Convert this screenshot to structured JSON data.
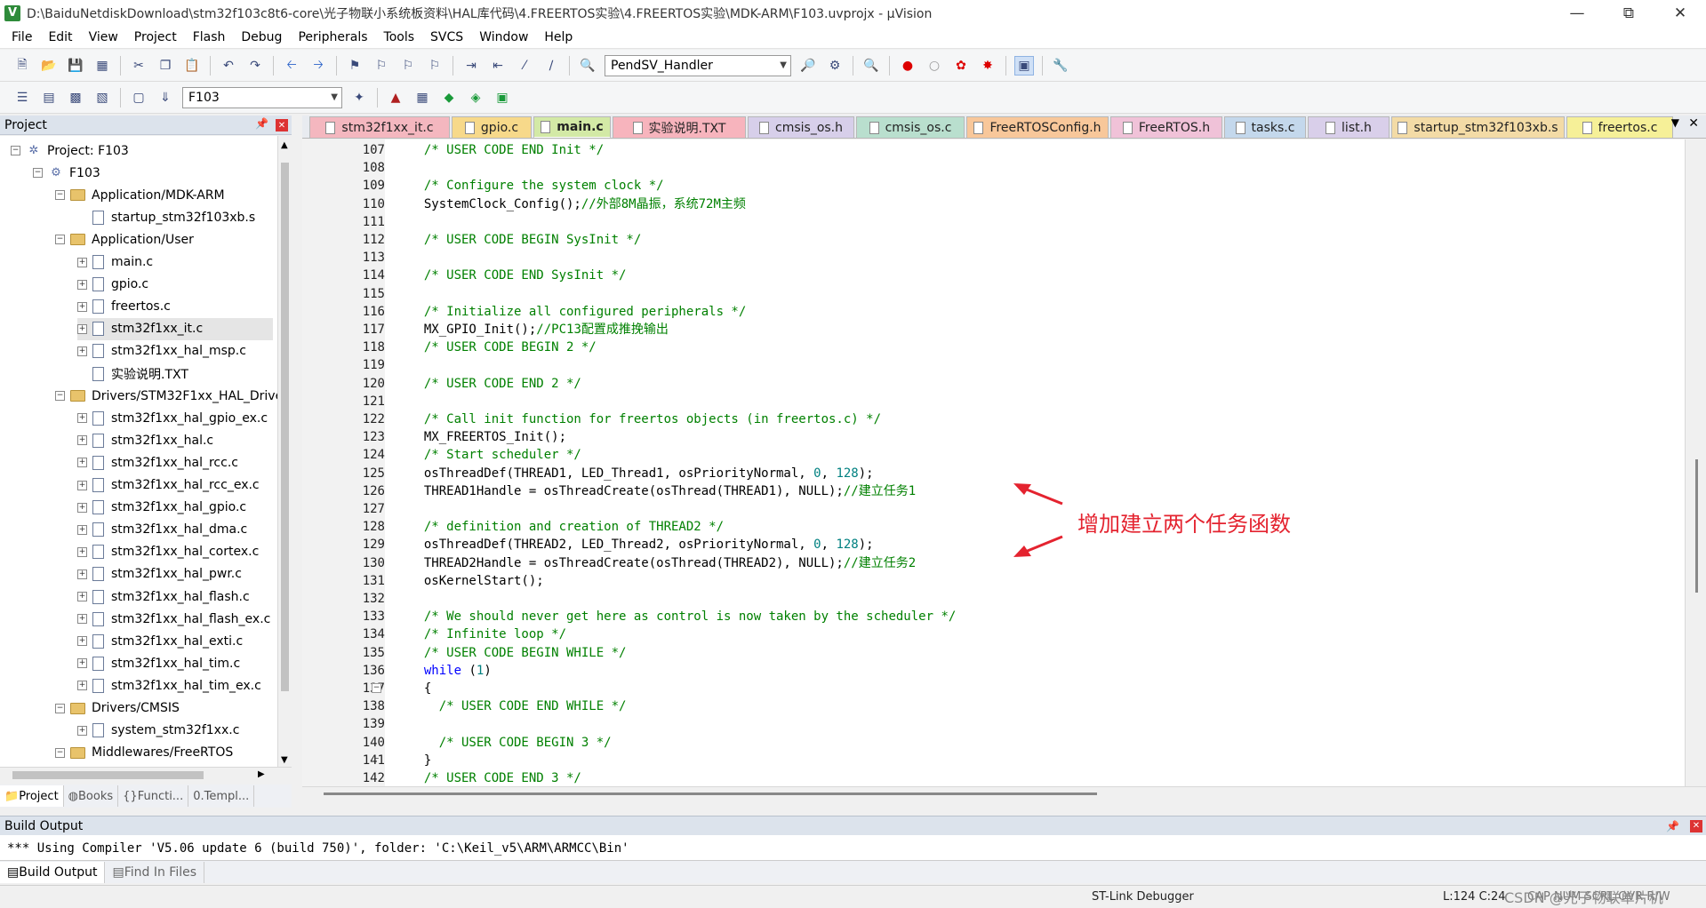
{
  "window": {
    "title": "D:\\BaiduNetdiskDownload\\stm32f103c8t6-core\\光子物联小系统板资料\\HAL库代码\\4.FREERTOS实验\\4.FREERTOS实验\\MDK-ARM\\F103.uvprojx - µVision",
    "icon_letter": "V"
  },
  "menu": [
    "File",
    "Edit",
    "View",
    "Project",
    "Flash",
    "Debug",
    "Peripherals",
    "Tools",
    "SVCS",
    "Window",
    "Help"
  ],
  "toolbar1": {
    "function_combo": "PendSV_Handler"
  },
  "toolbar2": {
    "target_combo": "F103"
  },
  "project_panel": {
    "title": "Project",
    "tree": [
      {
        "label": "Project: F103",
        "depth": 0,
        "kind": "project",
        "exp": "⊟"
      },
      {
        "label": "F103",
        "depth": 1,
        "kind": "target",
        "exp": "⊟"
      },
      {
        "label": "Application/MDK-ARM",
        "depth": 2,
        "kind": "folder",
        "exp": "⊟"
      },
      {
        "label": "startup_stm32f103xb.s",
        "depth": 3,
        "kind": "file",
        "exp": ""
      },
      {
        "label": "Application/User",
        "depth": 2,
        "kind": "folder",
        "exp": "⊟"
      },
      {
        "label": "main.c",
        "depth": 3,
        "kind": "file",
        "exp": "⊞"
      },
      {
        "label": "gpio.c",
        "depth": 3,
        "kind": "file",
        "exp": "⊞"
      },
      {
        "label": "freertos.c",
        "depth": 3,
        "kind": "file",
        "exp": "⊞"
      },
      {
        "label": "stm32f1xx_it.c",
        "depth": 3,
        "kind": "file",
        "exp": "⊞",
        "selected": true
      },
      {
        "label": "stm32f1xx_hal_msp.c",
        "depth": 3,
        "kind": "file",
        "exp": "⊞"
      },
      {
        "label": "实验说明.TXT",
        "depth": 3,
        "kind": "file",
        "exp": ""
      },
      {
        "label": "Drivers/STM32F1xx_HAL_Drive",
        "depth": 2,
        "kind": "folder",
        "exp": "⊟"
      },
      {
        "label": "stm32f1xx_hal_gpio_ex.c",
        "depth": 3,
        "kind": "file",
        "exp": "⊞"
      },
      {
        "label": "stm32f1xx_hal.c",
        "depth": 3,
        "kind": "file",
        "exp": "⊞"
      },
      {
        "label": "stm32f1xx_hal_rcc.c",
        "depth": 3,
        "kind": "file",
        "exp": "⊞"
      },
      {
        "label": "stm32f1xx_hal_rcc_ex.c",
        "depth": 3,
        "kind": "file",
        "exp": "⊞"
      },
      {
        "label": "stm32f1xx_hal_gpio.c",
        "depth": 3,
        "kind": "file",
        "exp": "⊞"
      },
      {
        "label": "stm32f1xx_hal_dma.c",
        "depth": 3,
        "kind": "file",
        "exp": "⊞"
      },
      {
        "label": "stm32f1xx_hal_cortex.c",
        "depth": 3,
        "kind": "file",
        "exp": "⊞"
      },
      {
        "label": "stm32f1xx_hal_pwr.c",
        "depth": 3,
        "kind": "file",
        "exp": "⊞"
      },
      {
        "label": "stm32f1xx_hal_flash.c",
        "depth": 3,
        "kind": "file",
        "exp": "⊞"
      },
      {
        "label": "stm32f1xx_hal_flash_ex.c",
        "depth": 3,
        "kind": "file",
        "exp": "⊞"
      },
      {
        "label": "stm32f1xx_hal_exti.c",
        "depth": 3,
        "kind": "file",
        "exp": "⊞"
      },
      {
        "label": "stm32f1xx_hal_tim.c",
        "depth": 3,
        "kind": "file",
        "exp": "⊞"
      },
      {
        "label": "stm32f1xx_hal_tim_ex.c",
        "depth": 3,
        "kind": "file",
        "exp": "⊞"
      },
      {
        "label": "Drivers/CMSIS",
        "depth": 2,
        "kind": "folder",
        "exp": "⊟"
      },
      {
        "label": "system_stm32f1xx.c",
        "depth": 3,
        "kind": "file",
        "exp": "⊞"
      },
      {
        "label": "Middlewares/FreeRTOS",
        "depth": 2,
        "kind": "folder",
        "exp": "⊟"
      }
    ],
    "tabs": [
      {
        "label": "Project",
        "icon": "📁",
        "active": true
      },
      {
        "label": "Books",
        "icon": "◍",
        "active": false
      },
      {
        "label": "Functi...",
        "icon": "{}",
        "active": false
      },
      {
        "label": "Templ...",
        "icon": "0.",
        "active": false
      }
    ]
  },
  "editor_tabs": [
    {
      "label": "stm32f1xx_it.c",
      "color": "#f4b7bf"
    },
    {
      "label": "gpio.c",
      "color": "#f7d98a"
    },
    {
      "label": "main.c",
      "color": "#d3e9a6",
      "active": true
    },
    {
      "label": "实验说明.TXT",
      "color": "#f7b4bd"
    },
    {
      "label": "cmsis_os.h",
      "color": "#d7cfea"
    },
    {
      "label": "cmsis_os.c",
      "color": "#b9dfce"
    },
    {
      "label": "FreeRTOSConfig.h",
      "color": "#f8c79a"
    },
    {
      "label": "FreeRTOS.h",
      "color": "#f0c2d8"
    },
    {
      "label": "tasks.c",
      "color": "#c4d8ec"
    },
    {
      "label": "list.h",
      "color": "#d9cfea"
    },
    {
      "label": "startup_stm32f103xb.s",
      "color": "#f3dba6"
    },
    {
      "label": "freertos.c",
      "color": "#f6f098"
    }
  ],
  "code_lines": [
    {
      "n": "107",
      "t": "  /* USER CODE END Init */",
      "k": "cm"
    },
    {
      "n": "108",
      "t": "",
      "k": ""
    },
    {
      "n": "109",
      "t": "  /* Configure the system clock */",
      "k": "cm"
    },
    {
      "n": "110",
      "t": "  SystemClock_Config();",
      "c": "//外部8M晶振，系统72M主频"
    },
    {
      "n": "111",
      "t": "",
      "k": ""
    },
    {
      "n": "112",
      "t": "  /* USER CODE BEGIN SysInit */",
      "k": "cm"
    },
    {
      "n": "113",
      "t": "",
      "k": ""
    },
    {
      "n": "114",
      "t": "  /* USER CODE END SysInit */",
      "k": "cm"
    },
    {
      "n": "115",
      "t": "",
      "k": ""
    },
    {
      "n": "116",
      "t": "  /* Initialize all configured peripherals */",
      "k": "cm"
    },
    {
      "n": "117",
      "t": "  MX_GPIO_Init();",
      "c": "//PC13配置成推挽输出"
    },
    {
      "n": "118",
      "t": "  /* USER CODE BEGIN 2 */",
      "k": "cm"
    },
    {
      "n": "119",
      "t": "",
      "k": ""
    },
    {
      "n": "120",
      "t": "  /* USER CODE END 2 */",
      "k": "cm"
    },
    {
      "n": "121",
      "t": "",
      "k": ""
    },
    {
      "n": "122",
      "t": "  /* Call init function for freertos objects (in freertos.c) */",
      "k": "cm"
    },
    {
      "n": "123",
      "t": "  MX_FREERTOS_Init();",
      "k": ""
    },
    {
      "n": "124",
      "t": "  /* Start scheduler */",
      "k": "cm"
    },
    {
      "n": "125",
      "t": "  osThreadDef(THREAD1, LED_Thread1, osPriorityNormal, ",
      "num": "0",
      "t2": ", ",
      "num2": "128",
      "t3": ");"
    },
    {
      "n": "126",
      "t": "  THREAD1Handle = osThreadCreate(osThread(THREAD1), NULL);",
      "c": "//建立任务1"
    },
    {
      "n": "127",
      "t": "",
      "k": ""
    },
    {
      "n": "128",
      "t": "  /* definition and creation of THREAD2 */",
      "k": "cm"
    },
    {
      "n": "129",
      "t": "  osThreadDef(THREAD2, LED_Thread2, osPriorityNormal, ",
      "num": "0",
      "t2": ", ",
      "num2": "128",
      "t3": ");"
    },
    {
      "n": "130",
      "t": "  THREAD2Handle = osThreadCreate(osThread(THREAD2), NULL);",
      "c": "//建立任务2"
    },
    {
      "n": "131",
      "t": "  osKernelStart();",
      "k": ""
    },
    {
      "n": "132",
      "t": "",
      "k": ""
    },
    {
      "n": "133",
      "t": "  /* We should never get here as control is now taken by the scheduler */",
      "k": "cm"
    },
    {
      "n": "134",
      "t": "  /* Infinite loop */",
      "k": "cm"
    },
    {
      "n": "135",
      "t": "  /* USER CODE BEGIN WHILE */",
      "k": "cm"
    },
    {
      "n": "136",
      "t": "  while",
      "kw": true,
      "t2": " (",
      "num": "1",
      "t3": ")"
    },
    {
      "n": "137",
      "t": "  {",
      "k": ""
    },
    {
      "n": "138",
      "t": "    /* USER CODE END WHILE */",
      "k": "cm"
    },
    {
      "n": "139",
      "t": "",
      "k": ""
    },
    {
      "n": "140",
      "t": "    /* USER CODE BEGIN 3 */",
      "k": "cm"
    },
    {
      "n": "141",
      "t": "  }",
      "k": ""
    },
    {
      "n": "142",
      "t": "  /* USER CODE END 3 */",
      "k": "cm"
    }
  ],
  "annotation": "增加建立两个任务函数",
  "build": {
    "title": "Build Output",
    "text": "*** Using Compiler 'V5.06 update 6 (build 750)', folder: 'C:\\Keil_v5\\ARM\\ARMCC\\Bin'",
    "tabs": [
      {
        "label": "Build Output",
        "active": true
      },
      {
        "label": "Find In Files",
        "active": false
      }
    ]
  },
  "status": {
    "debugger": "ST-Link Debugger",
    "position": "L:124 C:24",
    "flags": "CAP NUM SCRL OVR R/W",
    "watermark": "CSDN @光子物联单片机"
  }
}
